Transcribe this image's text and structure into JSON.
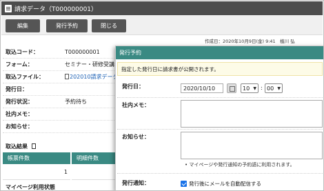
{
  "window": {
    "title": "請求データ（T000000001）",
    "icon": "document-list-icon"
  },
  "toolbar": {
    "edit_label": "編集",
    "schedule_label": "発行予約",
    "close_label": "閉じる"
  },
  "meta": {
    "created": "作成日：2020年10月9日(金) 9:41　植川 弘"
  },
  "form": [
    {
      "label": "取込コード：",
      "value": "T000000001"
    },
    {
      "label": "フォーム：",
      "value": "セミナー・研修受講"
    },
    {
      "label": "取込ファイル：",
      "value": "202010請求データ"
    },
    {
      "label": "発行日：",
      "value": ""
    },
    {
      "label": "発行状況：",
      "value": "予約待ち"
    },
    {
      "label": "社内メモ：",
      "value": ""
    },
    {
      "label": "お知らせ：",
      "value": ""
    }
  ],
  "results": {
    "title": "取込結果",
    "columns": [
      "帳票件数",
      "明細件数"
    ],
    "values": [
      "1",
      ""
    ],
    "next_section": "マイページ利用状態"
  },
  "modal": {
    "title": "発行予約",
    "info": "指定した発行日に請求書が公開されます。",
    "issue_date": {
      "label": "発行日：",
      "date": "2020/10/10",
      "hour": "10",
      "minute": "00",
      "separator": ":"
    },
    "memo": {
      "label": "社内メモ："
    },
    "notice": {
      "label": "お知らせ：",
      "hint": "•  マイページや発行通知の予約語に利用されます。"
    },
    "notify": {
      "label": "発行通知：",
      "checkbox_label": "発行後にメールを自動配信する",
      "checked": true
    }
  },
  "colors": {
    "accent": "#3a8a83",
    "titlebar": "#4d4d4d",
    "button": "#555555",
    "link": "#1a5fb4",
    "info_bg": "#fdfbe7"
  }
}
